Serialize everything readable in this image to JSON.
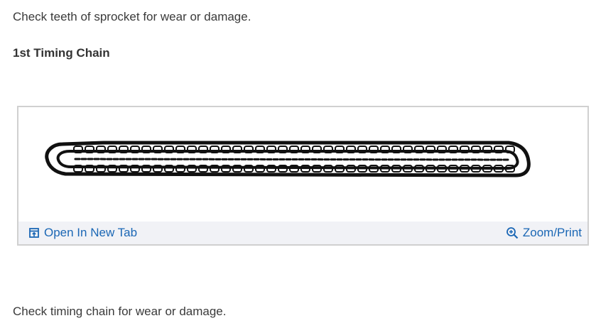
{
  "content": {
    "para_sprocket": "Check teeth of sprocket for wear or damage.",
    "heading": "1st Timing Chain",
    "para_chain": "Check timing chain for wear or damage."
  },
  "figure": {
    "open_tab_label": "Open In New Tab",
    "open_tab_icon": "open-in-new-tab-icon",
    "zoom_label": "Zoom/Print",
    "zoom_icon": "magnifier-plus-icon",
    "link_color": "#1b67b5",
    "bar_color": "#f1f2f6"
  }
}
